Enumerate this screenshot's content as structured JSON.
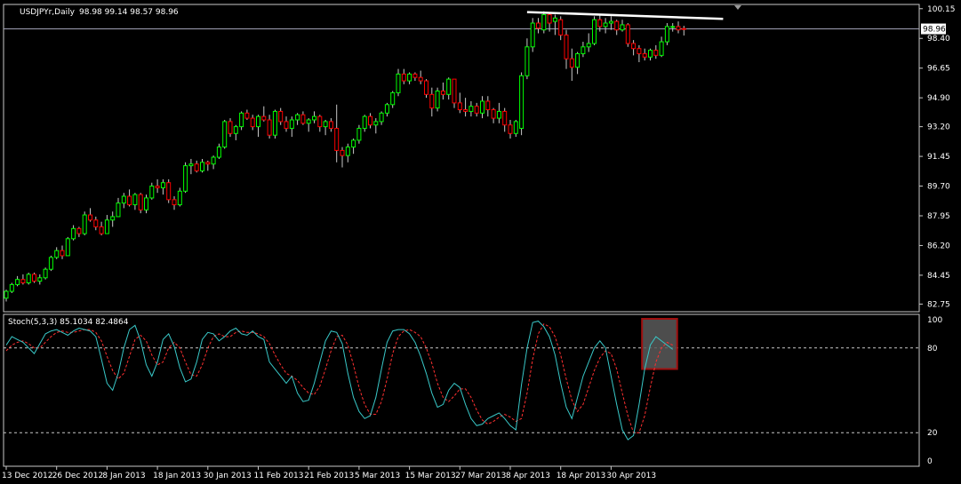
{
  "header": {
    "symbol": "USDJPYr,Daily",
    "ohlc": "98.98 99.14 98.57 98.96"
  },
  "colors": {
    "background": "#000000",
    "frame": "#c8c8c8",
    "bull": "#00ff00",
    "bear": "#ff0000",
    "wick": "#c8c8c8",
    "trendline": "#ffffff",
    "price_line": "#a0a0b4",
    "stoch_main": "#39c8c8",
    "stoch_signal": "#ff3030",
    "level_line": "#c8c8c8",
    "highlight_border": "#a01010",
    "highlight_fill": "#5a5a5a"
  },
  "chart_data": [
    {
      "type": "candlestick",
      "title": "USDJPYr,Daily",
      "current_price_label": "98.96",
      "current_price": 98.96,
      "ylim": [
        82.3,
        100.4
      ],
      "y_ticks": [
        "100.15",
        "98.40",
        "96.65",
        "94.90",
        "93.20",
        "91.45",
        "89.70",
        "87.95",
        "86.20",
        "84.45",
        "82.75"
      ],
      "x_ticks": [
        {
          "index": 0,
          "label": "13 Dec 2012"
        },
        {
          "index": 9,
          "label": "26 Dec 2012"
        },
        {
          "index": 18,
          "label": "8 Jan 2013"
        },
        {
          "index": 27,
          "label": "18 Jan 2013"
        },
        {
          "index": 36,
          "label": "30 Jan 2013"
        },
        {
          "index": 45,
          "label": "11 Feb 2013"
        },
        {
          "index": 54,
          "label": "21 Feb 2013"
        },
        {
          "index": 63,
          "label": "5 Mar 2013"
        },
        {
          "index": 72,
          "label": "15 Mar 2013"
        },
        {
          "index": 81,
          "label": "27 Mar 2013"
        },
        {
          "index": 90,
          "label": "8 Apr 2013"
        },
        {
          "index": 99,
          "label": "18 Apr 2013"
        },
        {
          "index": 108,
          "label": "30 Apr 2013"
        }
      ],
      "candles": [
        [
          83.1,
          83.6,
          82.9,
          83.5
        ],
        [
          83.5,
          84.0,
          83.4,
          83.9
        ],
        [
          83.9,
          84.4,
          83.8,
          84.2
        ],
        [
          84.2,
          84.5,
          83.9,
          84.0
        ],
        [
          84.0,
          84.6,
          83.9,
          84.5
        ],
        [
          84.5,
          84.6,
          84.0,
          84.1
        ],
        [
          84.1,
          84.5,
          83.9,
          84.3
        ],
        [
          84.3,
          84.9,
          84.2,
          84.8
        ],
        [
          84.8,
          85.6,
          84.7,
          85.5
        ],
        [
          85.5,
          86.1,
          85.4,
          85.9
        ],
        [
          85.9,
          86.2,
          85.4,
          85.6
        ],
        [
          85.6,
          86.7,
          85.6,
          86.6
        ],
        [
          86.6,
          87.4,
          86.5,
          87.2
        ],
        [
          87.2,
          87.3,
          86.7,
          86.9
        ],
        [
          86.9,
          88.2,
          86.8,
          88.0
        ],
        [
          88.0,
          88.4,
          87.6,
          87.7
        ],
        [
          87.7,
          87.9,
          87.1,
          87.3
        ],
        [
          87.3,
          87.6,
          86.8,
          86.9
        ],
        [
          86.9,
          88.0,
          86.9,
          87.7
        ],
        [
          87.7,
          88.2,
          87.3,
          87.9
        ],
        [
          87.9,
          89.0,
          87.9,
          88.7
        ],
        [
          88.7,
          89.3,
          88.4,
          89.1
        ],
        [
          89.1,
          89.5,
          88.5,
          88.6
        ],
        [
          88.6,
          89.3,
          88.3,
          89.2
        ],
        [
          89.2,
          89.3,
          88.1,
          88.3
        ],
        [
          88.3,
          89.2,
          88.1,
          89.0
        ],
        [
          89.0,
          89.9,
          88.9,
          89.7
        ],
        [
          89.7,
          90.1,
          89.3,
          89.6
        ],
        [
          89.6,
          90.1,
          89.2,
          89.9
        ],
        [
          89.9,
          90.1,
          88.7,
          88.9
        ],
        [
          88.9,
          89.1,
          88.3,
          88.6
        ],
        [
          88.6,
          89.6,
          88.5,
          89.4
        ],
        [
          89.4,
          91.1,
          89.3,
          90.9
        ],
        [
          90.9,
          91.3,
          90.4,
          91.0
        ],
        [
          91.0,
          91.2,
          90.5,
          90.6
        ],
        [
          90.6,
          91.3,
          90.5,
          91.1
        ],
        [
          91.1,
          91.2,
          90.6,
          91.0
        ],
        [
          91.0,
          91.5,
          90.7,
          91.4
        ],
        [
          91.4,
          92.2,
          91.3,
          92.0
        ],
        [
          92.0,
          93.6,
          91.9,
          93.5
        ],
        [
          93.5,
          93.7,
          92.6,
          92.8
        ],
        [
          92.8,
          93.3,
          92.4,
          93.2
        ],
        [
          93.2,
          94.1,
          93.0,
          94.0
        ],
        [
          94.0,
          94.2,
          93.6,
          93.7
        ],
        [
          93.7,
          93.9,
          93.0,
          93.2
        ],
        [
          93.2,
          93.9,
          92.6,
          93.8
        ],
        [
          93.8,
          94.4,
          93.5,
          93.6
        ],
        [
          93.6,
          93.9,
          92.5,
          92.7
        ],
        [
          92.7,
          94.2,
          92.5,
          94.1
        ],
        [
          94.1,
          94.3,
          93.3,
          93.5
        ],
        [
          93.5,
          93.8,
          92.9,
          93.1
        ],
        [
          93.1,
          93.8,
          92.6,
          93.6
        ],
        [
          93.6,
          94.0,
          93.3,
          93.9
        ],
        [
          93.9,
          94.1,
          93.3,
          93.4
        ],
        [
          93.4,
          93.7,
          92.9,
          93.6
        ],
        [
          93.6,
          94.1,
          93.4,
          93.8
        ],
        [
          93.8,
          93.9,
          92.9,
          93.2
        ],
        [
          93.2,
          93.6,
          92.7,
          93.5
        ],
        [
          93.5,
          93.7,
          92.9,
          93.1
        ],
        [
          93.1,
          94.5,
          91.1,
          91.8
        ],
        [
          91.8,
          92.0,
          90.8,
          91.5
        ],
        [
          91.5,
          92.2,
          91.1,
          92.0
        ],
        [
          92.0,
          92.5,
          91.6,
          92.4
        ],
        [
          92.4,
          93.3,
          92.2,
          93.1
        ],
        [
          93.1,
          93.9,
          92.9,
          93.8
        ],
        [
          93.8,
          94.0,
          93.1,
          93.3
        ],
        [
          93.3,
          93.7,
          92.8,
          93.5
        ],
        [
          93.5,
          94.1,
          93.3,
          94.0
        ],
        [
          94.0,
          94.6,
          93.8,
          94.5
        ],
        [
          94.5,
          95.3,
          94.3,
          95.2
        ],
        [
          95.2,
          96.6,
          95.0,
          96.3
        ],
        [
          96.3,
          96.6,
          95.7,
          95.9
        ],
        [
          95.9,
          96.4,
          95.7,
          96.3
        ],
        [
          96.3,
          96.4,
          95.9,
          96.1
        ],
        [
          96.1,
          96.5,
          95.7,
          95.9
        ],
        [
          95.9,
          96.0,
          94.9,
          95.1
        ],
        [
          95.1,
          95.5,
          93.8,
          94.3
        ],
        [
          94.3,
          95.5,
          94.1,
          95.3
        ],
        [
          95.3,
          95.8,
          94.8,
          95.1
        ],
        [
          95.1,
          96.1,
          94.8,
          96.0
        ],
        [
          96.0,
          96.0,
          94.3,
          94.6
        ],
        [
          94.6,
          95.2,
          94.0,
          94.2
        ],
        [
          94.2,
          94.9,
          93.8,
          94.1
        ],
        [
          94.1,
          94.7,
          93.8,
          94.4
        ],
        [
          94.4,
          94.6,
          93.8,
          94.0
        ],
        [
          94.0,
          95.0,
          93.7,
          94.7
        ],
        [
          94.7,
          95.0,
          93.8,
          94.2
        ],
        [
          94.2,
          94.3,
          93.4,
          93.7
        ],
        [
          93.7,
          94.6,
          93.4,
          94.1
        ],
        [
          94.1,
          94.3,
          92.9,
          93.3
        ],
        [
          93.3,
          93.6,
          92.5,
          92.8
        ],
        [
          92.8,
          93.6,
          92.6,
          93.5
        ],
        [
          93.1,
          96.4,
          92.7,
          96.2
        ],
        [
          96.2,
          98.4,
          96.0,
          97.9
        ],
        [
          97.9,
          99.6,
          97.6,
          99.3
        ],
        [
          99.3,
          99.6,
          98.7,
          99.0
        ],
        [
          98.9,
          100.0,
          98.7,
          99.8
        ],
        [
          99.8,
          99.9,
          98.8,
          99.3
        ],
        [
          99.4,
          99.8,
          98.6,
          99.6
        ],
        [
          99.5,
          99.7,
          98.3,
          98.6
        ],
        [
          98.6,
          98.9,
          96.6,
          97.2
        ],
        [
          97.2,
          97.8,
          95.9,
          96.7
        ],
        [
          96.7,
          97.6,
          96.3,
          97.5
        ],
        [
          97.5,
          98.2,
          97.3,
          97.9
        ],
        [
          97.9,
          98.7,
          97.6,
          98.1
        ],
        [
          98.1,
          99.7,
          98.0,
          99.5
        ],
        [
          99.5,
          99.8,
          98.8,
          99.1
        ],
        [
          99.1,
          99.6,
          98.7,
          99.3
        ],
        [
          99.3,
          99.7,
          98.9,
          99.4
        ],
        [
          99.4,
          99.5,
          98.6,
          98.9
        ],
        [
          98.9,
          99.5,
          98.8,
          99.2
        ],
        [
          99.2,
          99.3,
          97.9,
          98.1
        ],
        [
          98.1,
          98.3,
          97.4,
          97.8
        ],
        [
          97.8,
          98.0,
          97.0,
          97.5
        ],
        [
          97.5,
          97.8,
          97.1,
          97.3
        ],
        [
          97.3,
          97.8,
          97.1,
          97.7
        ],
        [
          97.7,
          98.0,
          97.2,
          97.4
        ],
        [
          97.4,
          98.5,
          97.3,
          98.2
        ],
        [
          98.2,
          99.3,
          98.0,
          99.1
        ],
        [
          99.1,
          99.3,
          98.8,
          99.1
        ],
        [
          99.1,
          99.4,
          98.7,
          98.9
        ],
        [
          98.98,
          99.14,
          98.57,
          98.96
        ]
      ],
      "trendline": {
        "from": [
          93,
          99.95
        ],
        "to": [
          128,
          99.55
        ]
      }
    },
    {
      "type": "line",
      "title": "Stoch(5,3,3) 85.1034 82.4864",
      "ylim": [
        0,
        100
      ],
      "y_ticks": [
        100,
        80,
        20,
        0
      ],
      "levels": [
        80,
        20
      ],
      "highlight": {
        "from_index": 114,
        "to_index": 119,
        "y_from": 72,
        "y_to": 100
      },
      "series": [
        {
          "values": [
            82,
            88,
            86,
            84,
            80,
            76,
            83,
            90,
            92,
            93,
            91,
            89,
            92,
            94,
            93,
            92,
            88,
            72,
            55,
            50,
            62,
            80,
            93,
            96,
            85,
            68,
            60,
            70,
            86,
            90,
            81,
            66,
            56,
            58,
            70,
            86,
            91,
            90,
            85,
            88,
            92,
            94,
            90,
            89,
            92,
            88,
            86,
            70,
            65,
            60,
            55,
            60,
            48,
            42,
            43,
            55,
            70,
            85,
            92,
            91,
            83,
            62,
            45,
            35,
            30,
            32,
            45,
            65,
            84,
            92,
            93,
            93,
            90,
            84,
            74,
            62,
            48,
            38,
            40,
            50,
            55,
            52,
            40,
            30,
            25,
            26,
            30,
            32,
            34,
            30,
            25,
            22,
            54,
            80,
            98,
            99,
            95,
            88,
            75,
            55,
            38,
            30,
            45,
            60,
            70,
            80,
            85,
            80,
            60,
            40,
            22,
            15,
            18,
            40,
            65,
            82,
            88,
            85,
            82,
            79
          ]
        },
        {
          "values": [
            78,
            82,
            84,
            85,
            83,
            80,
            80,
            84,
            88,
            91,
            92,
            91,
            91,
            92,
            93,
            93,
            91,
            85,
            74,
            64,
            58,
            62,
            74,
            86,
            89,
            85,
            75,
            68,
            70,
            80,
            84,
            80,
            70,
            61,
            60,
            68,
            80,
            88,
            90,
            88,
            88,
            91,
            92,
            91,
            91,
            90,
            88,
            83,
            75,
            68,
            62,
            60,
            57,
            52,
            48,
            47,
            53,
            65,
            78,
            88,
            89,
            82,
            68,
            52,
            40,
            33,
            33,
            42,
            58,
            76,
            88,
            92,
            93,
            91,
            88,
            80,
            69,
            55,
            45,
            42,
            46,
            51,
            51,
            45,
            36,
            29,
            26,
            28,
            31,
            33,
            31,
            28,
            30,
            48,
            72,
            90,
            97,
            95,
            88,
            75,
            58,
            43,
            35,
            40,
            52,
            64,
            73,
            78,
            76,
            65,
            48,
            32,
            20,
            20,
            32,
            52,
            70,
            80,
            84,
            82
          ]
        }
      ]
    }
  ]
}
